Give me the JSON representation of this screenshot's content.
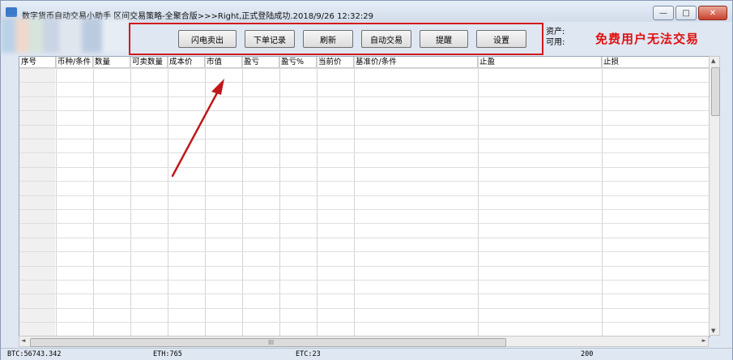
{
  "window": {
    "title": "数字货币自动交易小助手 区间交易策略-全聚合版>>>Right,正式登陆成功.2018/9/26 12:32:29",
    "controls": {
      "minimize": "—",
      "maximize": "□",
      "close": "✕"
    }
  },
  "toolbar": {
    "buttons": [
      "闪电卖出",
      "下单记录",
      "刷新",
      "自动交易",
      "提醒",
      "设置"
    ]
  },
  "account": {
    "asset_label": "资产:",
    "available_label": "可用:",
    "notice": "免费用户无法交易"
  },
  "table": {
    "columns": [
      "序号",
      "币种/条件",
      "数量",
      "可卖数量",
      "成本价",
      "市值",
      "盈亏",
      "盈亏%",
      "当前价",
      "基准价/条件",
      "止盈",
      "止损"
    ]
  },
  "scrollbars": {
    "grip": "III",
    "up": "▲",
    "down": "▼",
    "left": "◄",
    "right": "►"
  },
  "status_bar": {
    "btc": "BTC:56743.342",
    "eth": "ETH:765",
    "etc": "ETC:23",
    "count": "200"
  },
  "colors": {
    "highlight": "#d11a1a",
    "notice": "#e01010",
    "arrow": "#c0171a"
  }
}
